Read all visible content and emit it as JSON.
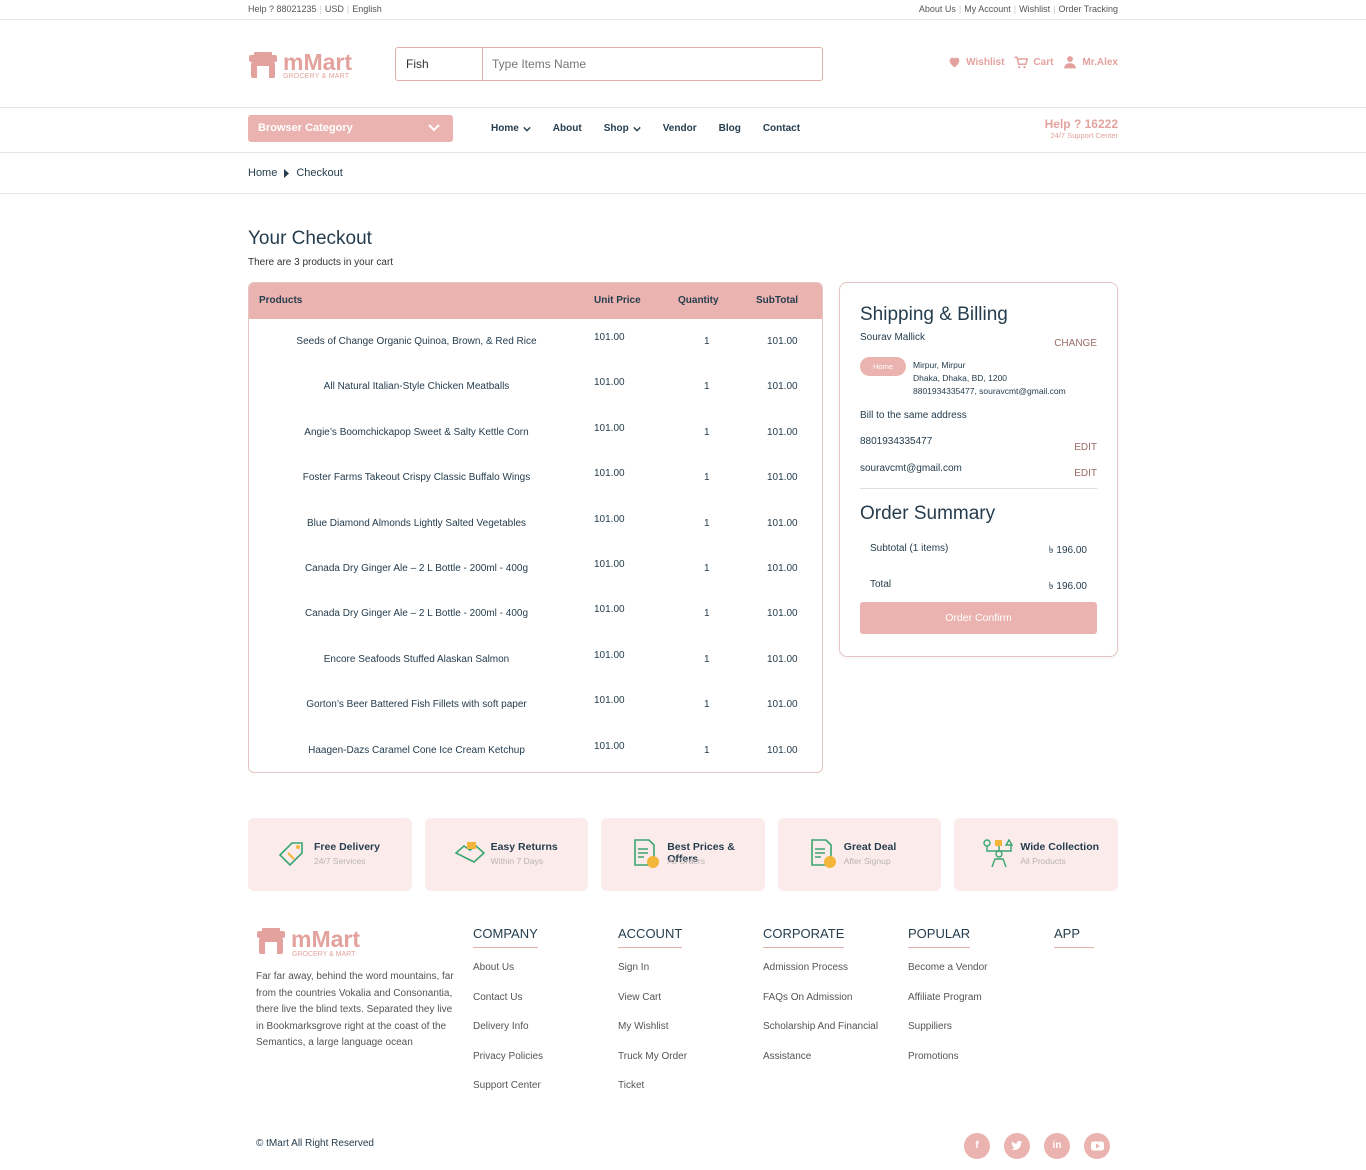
{
  "topbar": {
    "help": "Help ? 88021235",
    "currency": "USD",
    "language": "English",
    "links": [
      "About Us",
      "My Account",
      "Wishlist",
      "Order Tracking"
    ]
  },
  "brand": {
    "name": "mMart",
    "tagline": "GROCERY & MART",
    "color": "#e3a29d"
  },
  "search": {
    "category": "Fish",
    "placeholder": "Type Items Name"
  },
  "header_actions": {
    "wishlist": "Wishlist",
    "cart": "Cart",
    "user": "Mr.Alex"
  },
  "nav": {
    "browse": "Browser Category",
    "items": [
      "Home",
      "About",
      "Shop",
      "Vendor",
      "Blog",
      "Contact"
    ],
    "help_title": "Help ? 16222",
    "help_sub": "24/7 Support Center"
  },
  "breadcrumb": {
    "home": "Home",
    "current": "Checkout"
  },
  "page": {
    "title": "Your Checkout",
    "subtitle": "There are 3 products in your cart"
  },
  "cart": {
    "columns": [
      "Products",
      "Unit Price",
      "Quantity",
      "SubTotal"
    ],
    "rows": [
      {
        "product": "Seeds of Change Organic Quinoa, Brown, & Red Rice",
        "price": "101.00",
        "qty": "1",
        "subtotal": "101.00"
      },
      {
        "product": "All Natural Italian-Style Chicken Meatballs",
        "price": "101.00",
        "qty": "1",
        "subtotal": "101.00"
      },
      {
        "product": "Angie’s Boomchickapop Sweet & Salty Kettle Corn",
        "price": "101.00",
        "qty": "1",
        "subtotal": "101.00"
      },
      {
        "product": "Foster Farms Takeout Crispy Classic Buffalo Wings",
        "price": "101.00",
        "qty": "1",
        "subtotal": "101.00"
      },
      {
        "product": "Blue Diamond Almonds Lightly Salted Vegetables",
        "price": "101.00",
        "qty": "1",
        "subtotal": "101.00"
      },
      {
        "product": "Canada Dry Ginger Ale – 2 L Bottle - 200ml - 400g",
        "price": "101.00",
        "qty": "1",
        "subtotal": "101.00"
      },
      {
        "product": "Canada Dry Ginger Ale – 2 L Bottle - 200ml - 400g",
        "price": "101.00",
        "qty": "1",
        "subtotal": "101.00"
      },
      {
        "product": "Encore Seafoods Stuffed Alaskan Salmon",
        "price": "101.00",
        "qty": "1",
        "subtotal": "101.00"
      },
      {
        "product": "Gorton’s Beer Battered Fish Fillets with soft paper",
        "price": "101.00",
        "qty": "1",
        "subtotal": "101.00"
      },
      {
        "product": "Haagen-Dazs Caramel Cone Ice Cream Ketchup",
        "price": "101.00",
        "qty": "1",
        "subtotal": "101.00"
      }
    ]
  },
  "shipping": {
    "title": "Shipping & Billing",
    "name": "Sourav Mallick",
    "change": "CHANGE",
    "tag": "Home",
    "addr1": "Mirpur, Mirpur",
    "addr2": "Dhaka, Dhaka, BD, 1200",
    "addr3": "8801934335477, souravcmt@gmail.com",
    "bill": "Bill to the same address",
    "phone": "8801934335477",
    "email": "souravcmt@gmail.com",
    "edit": "EDIT"
  },
  "summary": {
    "title": "Order Summary",
    "subtotal_label": "Subtotal (1 items)",
    "subtotal_value": "৳ 196.00",
    "total_label": "Total",
    "total_value": "৳ 196.00",
    "confirm": "Order Confirm"
  },
  "features": [
    {
      "title": "Free Delivery",
      "sub": "24/7 Services",
      "icon": "delivery-tag-icon"
    },
    {
      "title": "Easy Returns",
      "sub": "Within 7 Days",
      "icon": "handshake-icon"
    },
    {
      "title": "Best Prices & Offers",
      "sub": "All Orders",
      "icon": "invoice-coin-icon"
    },
    {
      "title": "Great Deal",
      "sub": "After Signup",
      "icon": "invoice-coin-icon"
    },
    {
      "title": "Wide Collection",
      "sub": "All Products",
      "icon": "network-people-icon"
    }
  ],
  "footer": {
    "description": "Far far away, behind the word mountains, far from the countries Vokalia and Consonantia, there live the blind texts. Separated they live in Bookmarksgrove right at the coast of the Semantics, a large language ocean",
    "columns": [
      {
        "title": "COMPANY",
        "links": [
          "About Us",
          "Contact Us",
          "Delivery Info",
          "Privacy Policies",
          "Support Center"
        ]
      },
      {
        "title": "ACCOUNT",
        "links": [
          "Sign In",
          "View Cart",
          "My Wishlist",
          "Truck My Order",
          "Ticket"
        ]
      },
      {
        "title": "CORPORATE",
        "links": [
          "Admission Process",
          "FAQs On Admission",
          "Scholarship And Financial",
          "Assistance"
        ]
      },
      {
        "title": "POPULAR",
        "links": [
          "Become a Vendor",
          "Affiliate Program",
          "Suppiliers",
          "Promotions"
        ]
      },
      {
        "title": "APP",
        "links": []
      }
    ],
    "copyright": "© tMart All Right Reserved",
    "social": [
      "f",
      "t",
      "in",
      "yt"
    ]
  }
}
